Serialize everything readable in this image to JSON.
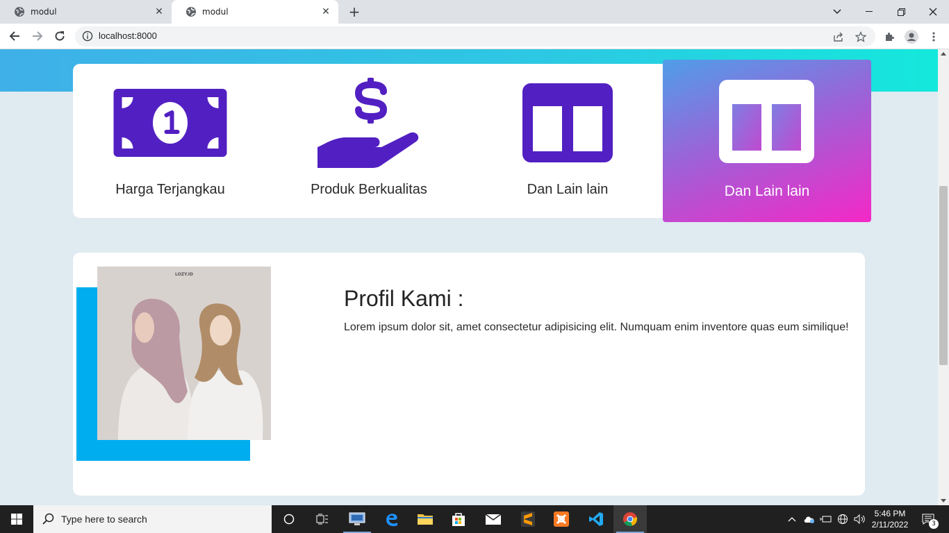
{
  "browser": {
    "tabs": [
      {
        "title": "modul"
      },
      {
        "title": "modul"
      }
    ],
    "new_tab_symbol": "+",
    "address": "localhost:8000"
  },
  "features": [
    {
      "label": "Harga Terjangkau",
      "icon": "money-bill-icon"
    },
    {
      "label": "Produk Berkualitas",
      "icon": "hand-dollar-icon"
    },
    {
      "label": "Dan Lain lain",
      "icon": "columns-icon"
    },
    {
      "label": "Dan Lain lain",
      "icon": "columns-icon",
      "active": true
    }
  ],
  "profile": {
    "photo_brand": "LOZY.ID",
    "title": "Profil Kami :",
    "text": "Lorem ipsum dolor sit, amet consectetur adipisicing elit. Numquam enim inventore quas eum similique!"
  },
  "colors": {
    "accent_purple": "#5220c2",
    "hero_band": "#2cc9e3",
    "photo_frame": "#00adef",
    "active_gradient_start": "#4f9ee8",
    "active_gradient_end": "#f528c6"
  },
  "taskbar": {
    "search_placeholder": "Type here to search",
    "time": "5:46 PM",
    "date": "2/11/2022",
    "notification_count": "3"
  }
}
